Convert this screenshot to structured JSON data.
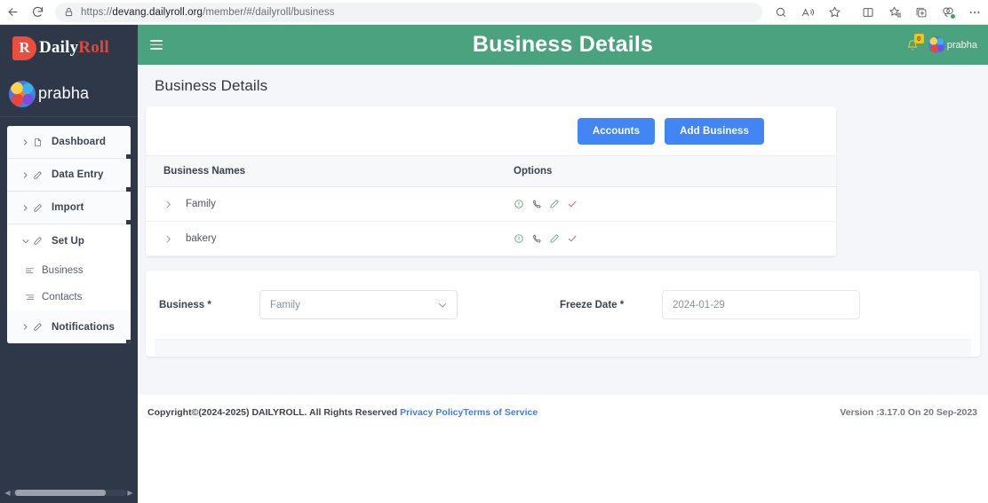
{
  "browser": {
    "url_prefix": "https://",
    "url_domain": "devang.dailyroll.org",
    "url_path": "/member/#/dailyroll/business",
    "back_icon": "back-arrow-icon",
    "reload_icon": "reload-icon",
    "lock_icon": "lock-icon",
    "toolbar_icons": [
      "search-icon",
      "read-aloud-icon",
      "favorites-star-icon",
      "split-screen-icon",
      "collections-icon",
      "browser-app-icon",
      "browser-essentials-icon",
      "settings-ellipsis-icon"
    ]
  },
  "sidebar": {
    "logo_mark": "R",
    "logo_word1": "Daily",
    "logo_word2": "Roll",
    "profile_name": "prabha",
    "items": [
      {
        "label": "Dashboard",
        "icon": "file-icon",
        "expanded": false
      },
      {
        "label": "Data Entry",
        "icon": "pencil-icon",
        "expanded": false
      },
      {
        "label": "Import",
        "icon": "pencil-icon",
        "expanded": false
      },
      {
        "label": "Set Up",
        "icon": "pencil-icon",
        "expanded": true
      },
      {
        "label": "Notifications",
        "icon": "pencil-icon",
        "expanded": false
      }
    ],
    "sub_items": [
      {
        "label": "Business",
        "icon": "align-left-icon"
      },
      {
        "label": "Contacts",
        "icon": "align-right-icon"
      }
    ]
  },
  "topbar": {
    "menu_icon": "hamburger-icon",
    "title": "Business Details",
    "bell_icon": "bell-icon",
    "bell_count": "0",
    "user_name": "prabha",
    "background": "#4aa37e"
  },
  "page": {
    "title": "Business Details"
  },
  "actions": {
    "accounts_label": "Accounts",
    "add_business_label": "Add Business",
    "button_color": "#4285f4"
  },
  "table": {
    "columns": [
      "Business Names",
      "Options"
    ],
    "rows": [
      {
        "name": "Family",
        "options": [
          "info-icon",
          "phone-icon",
          "edit-pencil-icon",
          "check-icon"
        ]
      },
      {
        "name": "bakery",
        "options": [
          "info-icon",
          "phone-icon",
          "edit-pencil-icon",
          "check-icon"
        ]
      }
    ],
    "row_expand_icon": "chevron-right-icon"
  },
  "form": {
    "business_label": "Business *",
    "business_value": "Family",
    "business_caret": "chevron-down-icon",
    "freeze_date_label": "Freeze Date *",
    "freeze_date_value": "2024-01-29"
  },
  "footer": {
    "copyright": "Copyright©(2024-2025) DAILYROLL. All Rights Reserved ",
    "privacy_link": "Privacy Policy",
    "terms_link": "Terms of Service",
    "version": "Version :3.17.0 On 20 Sep-2023"
  }
}
